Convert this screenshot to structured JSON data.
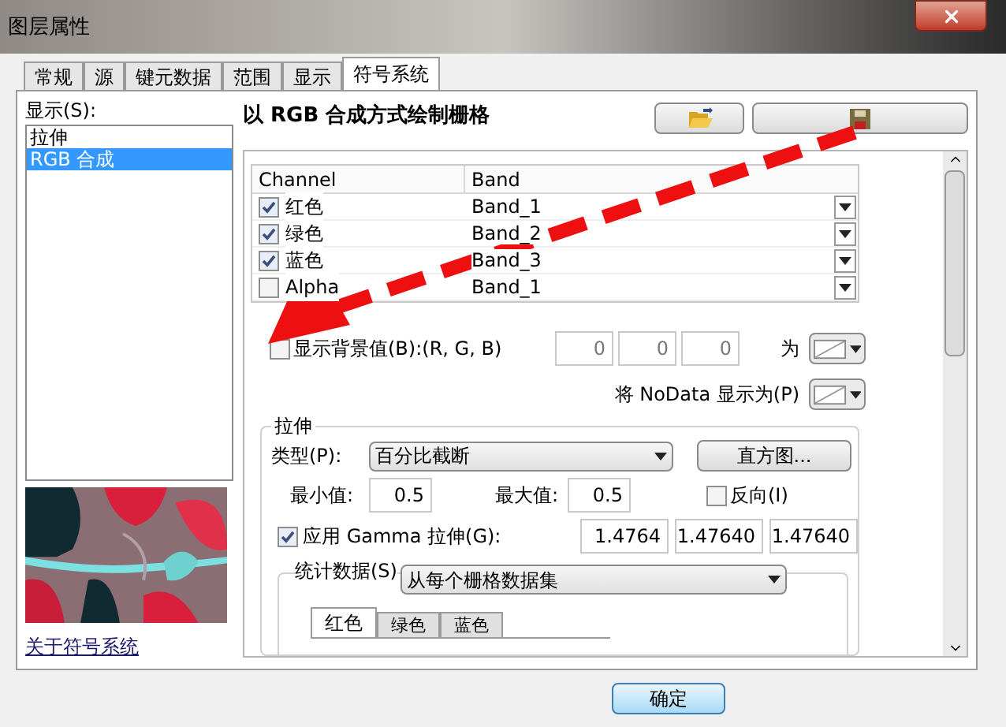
{
  "window": {
    "title": "图层属性"
  },
  "tabs": [
    {
      "label": "常规",
      "selected": false
    },
    {
      "label": "源",
      "selected": false
    },
    {
      "label": "键元数据",
      "selected": false
    },
    {
      "label": "范围",
      "selected": false
    },
    {
      "label": "显示",
      "selected": false
    },
    {
      "label": "符号系统",
      "selected": true
    }
  ],
  "display": {
    "label": "显示(S):",
    "items": [
      {
        "label": "拉伸",
        "selected": false
      },
      {
        "label": "RGB 合成",
        "selected": true
      }
    ]
  },
  "about_link": "关于符号系统",
  "heading": "以 RGB 合成方式绘制栅格",
  "table": {
    "columns": [
      "Channel",
      "Band"
    ],
    "rows": [
      {
        "channel": "红色",
        "checked": true,
        "band": "Band_1"
      },
      {
        "channel": "绿色",
        "checked": true,
        "band": "Band_2"
      },
      {
        "channel": "蓝色",
        "checked": true,
        "band": "Band_3"
      },
      {
        "channel": "Alpha",
        "checked": false,
        "band": "Band_1"
      }
    ]
  },
  "background": {
    "label": "显示背景值(B):(R, G, B)",
    "checked": false,
    "values": [
      "0",
      "0",
      "0"
    ],
    "as_label": "为"
  },
  "nodata": {
    "label": "将 NoData 显示为(P)"
  },
  "stretch": {
    "title": "拉伸",
    "type_label": "类型(P):",
    "type": "百分比截断",
    "histogram_button": "直方图...",
    "min_label": "最小值:",
    "min": "0.5",
    "max_label": "最大值:",
    "max": "0.5",
    "invert": {
      "label": "反向(I)",
      "checked": false
    },
    "gamma": {
      "label": "应用 Gamma 拉伸(G):",
      "checked": true,
      "values": [
        "1.4764",
        "1.47640",
        "1.47640"
      ]
    }
  },
  "statistics": {
    "label": "统计数据(S)",
    "source": "从每个栅格数据集",
    "tabs": [
      {
        "label": "红色",
        "selected": true
      },
      {
        "label": "绿色",
        "selected": false
      },
      {
        "label": "蓝色",
        "selected": false
      }
    ]
  },
  "ok_button": "确定"
}
